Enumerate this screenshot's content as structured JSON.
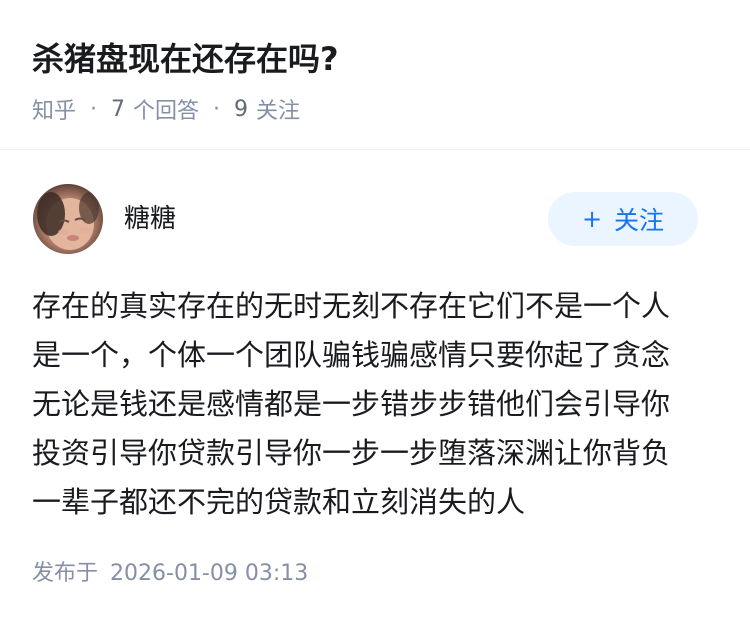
{
  "question": {
    "title": "杀猪盘现在还存在吗?",
    "source": "知乎",
    "separator": "·",
    "answers_count": "7",
    "answers_label": "个回答",
    "followers_count": "9",
    "followers_label": "关注"
  },
  "answer": {
    "author_name": "糖糖",
    "avatar_icon": "avatar-photo",
    "follow_button": {
      "icon": "plus-icon",
      "icon_glyph": "+",
      "label": "关注"
    },
    "body_lines": [
      "存在的真实存在的无时无刻不存在它们不是一个人",
      "是一个，个体一个团队骗钱骗感情只要你起了贪念",
      "无论是钱还是感情都是一步错步步错他们会引导你",
      "投资引导你贷款引导你一步一步堕落深渊让你背负",
      "一辈子都还不完的贷款和立刻消失的人"
    ],
    "publish_label": "发布于",
    "publish_time": "2026-01-09 03:13"
  },
  "colors": {
    "primary": "#1772f6",
    "follow_bg": "#ebf5ff",
    "meta_text": "#8590a6",
    "body_text": "#191b1f"
  }
}
